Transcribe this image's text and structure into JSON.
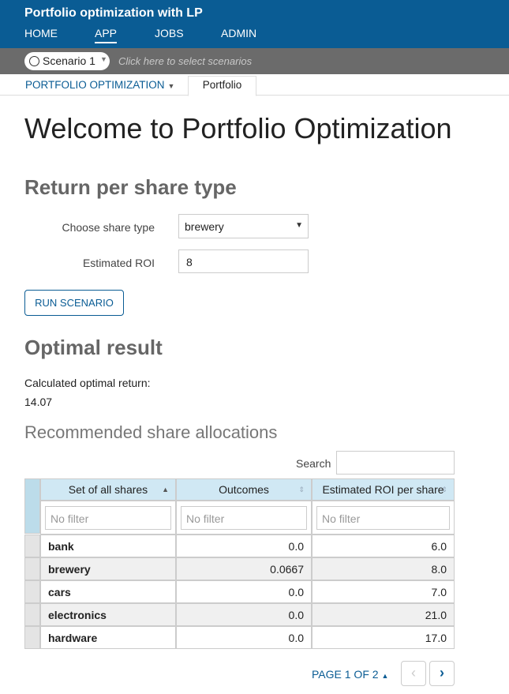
{
  "app": {
    "title": "Portfolio optimization with LP",
    "nav": [
      "HOME",
      "APP",
      "JOBS",
      "ADMIN"
    ],
    "active_nav": "APP"
  },
  "scenario": {
    "name": "Scenario 1",
    "hint": "Click here to select scenarios"
  },
  "tabs": {
    "dashboard_menu": "PORTFOLIO OPTIMIZATION",
    "active_tab": "Portfolio"
  },
  "main": {
    "title": "Welcome to Portfolio Optimization",
    "section_return": "Return per share type",
    "share_type_label": "Choose share type",
    "share_type_value": "brewery",
    "roi_label": "Estimated ROI",
    "roi_value": "8",
    "run_button": "RUN SCENARIO",
    "section_result": "Optimal result",
    "result_label": "Calculated optimal return:",
    "result_value": "14.07",
    "allocations_title": "Recommended share allocations"
  },
  "table": {
    "search_label": "Search",
    "headers": [
      "Set of all shares",
      "Outcomes",
      "Estimated ROI per share"
    ],
    "filter_placeholder": "No filter",
    "rows": [
      [
        "bank",
        "0.0",
        "6.0"
      ],
      [
        "brewery",
        "0.0667",
        "8.0"
      ],
      [
        "cars",
        "0.0",
        "7.0"
      ],
      [
        "electronics",
        "0.0",
        "21.0"
      ],
      [
        "hardware",
        "0.0",
        "17.0"
      ]
    ]
  },
  "pager": {
    "label": "PAGE 1 OF 2"
  },
  "colors": {
    "brand_blue": "#0a5c94",
    "scenario_bar": "#6b6b6b",
    "header_cell": "#d0e8f4"
  },
  "icons": {
    "scenario": "radio-circle-icon",
    "sort": "sort-arrows-icon",
    "prev": "chevron-left-icon",
    "next": "chevron-right-icon"
  }
}
